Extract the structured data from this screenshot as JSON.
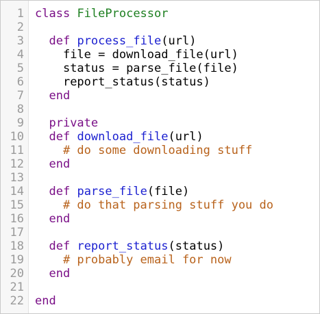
{
  "editor": {
    "language": "ruby",
    "colors": {
      "keyword": "#7a0f87",
      "class_name": "#1d7f20",
      "function_name": "#1a1fd0",
      "comment": "#b8621b",
      "plain": "#000000",
      "line_number": "#9a9a9a"
    },
    "lines": [
      {
        "num": "1",
        "indent": "",
        "tokens": [
          {
            "t": "kw",
            "v": "class"
          },
          {
            "t": "tx",
            "v": " "
          },
          {
            "t": "cls",
            "v": "FileProcessor"
          }
        ]
      },
      {
        "num": "2",
        "indent": "",
        "tokens": []
      },
      {
        "num": "3",
        "indent": "  ",
        "tokens": [
          {
            "t": "kw",
            "v": "def"
          },
          {
            "t": "tx",
            "v": " "
          },
          {
            "t": "fn",
            "v": "process_file"
          },
          {
            "t": "tx",
            "v": "(url)"
          }
        ]
      },
      {
        "num": "4",
        "indent": "    ",
        "tokens": [
          {
            "t": "tx",
            "v": "file = download_file(url)"
          }
        ]
      },
      {
        "num": "5",
        "indent": "    ",
        "tokens": [
          {
            "t": "tx",
            "v": "status = parse_file(file)"
          }
        ]
      },
      {
        "num": "6",
        "indent": "    ",
        "tokens": [
          {
            "t": "tx",
            "v": "report_status(status)"
          }
        ]
      },
      {
        "num": "7",
        "indent": "  ",
        "tokens": [
          {
            "t": "kw",
            "v": "end"
          }
        ]
      },
      {
        "num": "8",
        "indent": "",
        "tokens": []
      },
      {
        "num": "9",
        "indent": "  ",
        "tokens": [
          {
            "t": "kw",
            "v": "private"
          }
        ]
      },
      {
        "num": "10",
        "indent": "  ",
        "tokens": [
          {
            "t": "kw",
            "v": "def"
          },
          {
            "t": "tx",
            "v": " "
          },
          {
            "t": "fn",
            "v": "download_file"
          },
          {
            "t": "tx",
            "v": "(url)"
          }
        ]
      },
      {
        "num": "11",
        "indent": "    ",
        "tokens": [
          {
            "t": "cm",
            "v": "# do some downloading stuff"
          }
        ]
      },
      {
        "num": "12",
        "indent": "  ",
        "tokens": [
          {
            "t": "kw",
            "v": "end"
          }
        ]
      },
      {
        "num": "13",
        "indent": "",
        "tokens": []
      },
      {
        "num": "14",
        "indent": "  ",
        "tokens": [
          {
            "t": "kw",
            "v": "def"
          },
          {
            "t": "tx",
            "v": " "
          },
          {
            "t": "fn",
            "v": "parse_file"
          },
          {
            "t": "tx",
            "v": "(file)"
          }
        ]
      },
      {
        "num": "15",
        "indent": "    ",
        "tokens": [
          {
            "t": "cm",
            "v": "# do that parsing stuff you do"
          }
        ]
      },
      {
        "num": "16",
        "indent": "  ",
        "tokens": [
          {
            "t": "kw",
            "v": "end"
          }
        ]
      },
      {
        "num": "17",
        "indent": "",
        "tokens": []
      },
      {
        "num": "18",
        "indent": "  ",
        "tokens": [
          {
            "t": "kw",
            "v": "def"
          },
          {
            "t": "tx",
            "v": " "
          },
          {
            "t": "fn",
            "v": "report_status"
          },
          {
            "t": "tx",
            "v": "(status)"
          }
        ]
      },
      {
        "num": "19",
        "indent": "    ",
        "tokens": [
          {
            "t": "cm",
            "v": "# probably email for now"
          }
        ]
      },
      {
        "num": "20",
        "indent": "  ",
        "tokens": [
          {
            "t": "kw",
            "v": "end"
          }
        ]
      },
      {
        "num": "21",
        "indent": "",
        "tokens": []
      },
      {
        "num": "22",
        "indent": "",
        "tokens": [
          {
            "t": "kw",
            "v": "end"
          }
        ]
      }
    ]
  }
}
